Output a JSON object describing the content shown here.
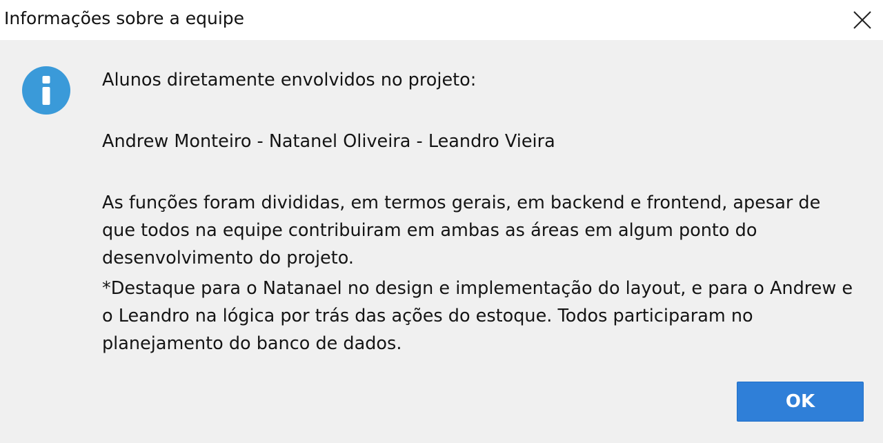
{
  "window": {
    "title": "Informações sobre a equipe",
    "close_icon": "close-icon"
  },
  "dialog": {
    "icon": "info-icon",
    "icon_color": "#3a9ad9",
    "lines": {
      "heading": "Alunos diretamente envolvidos no projeto:",
      "members": "Andrew Monteiro - Natanel Oliveira - Leandro Vieira",
      "para1_line1": "As funções foram divididas, em termos gerais, em backend e frontend, apesar de",
      "para1_line2": "que todos na equipe contribuiram em ambas as áreas em algum ponto do",
      "para1_line3": "desenvolvimento do projeto.",
      "para2_line1": "*Destaque para o Natanael no design e implementação do layout, e para o Andrew e",
      "para2_line2": "o Leandro na lógica por trás das ações do estoque. Todos participaram no",
      "para2_line3": "planejamento do banco de dados."
    },
    "ok_label": "OK",
    "ok_color": "#2f7fd8"
  }
}
